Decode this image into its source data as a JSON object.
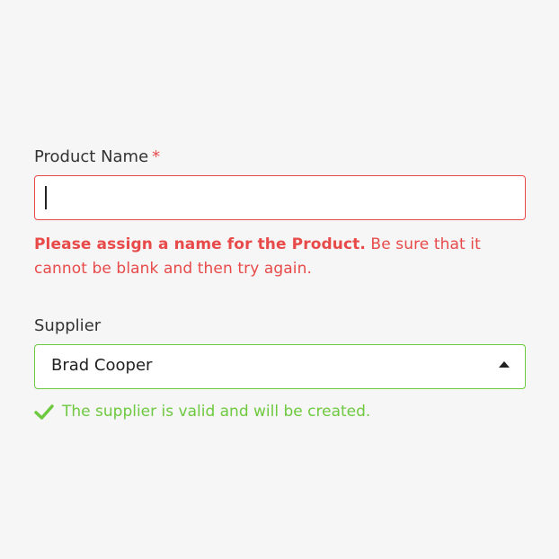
{
  "product_name": {
    "label": "Product Name",
    "required_mark": "*",
    "value": "",
    "error_bold": "Please assign a name for the Product.",
    "error_rest": " Be sure that it cannot be blank and then try again."
  },
  "supplier": {
    "label": "Supplier",
    "selected": "Brad Cooper",
    "success_message": "The supplier is valid and will be created."
  },
  "colors": {
    "background": "#f6f6f6",
    "error": "#e84a4a",
    "success": "#6dc93f",
    "text": "#333333"
  },
  "icons": {
    "dropdown": "caret-up-icon",
    "success": "checkmark-icon"
  }
}
